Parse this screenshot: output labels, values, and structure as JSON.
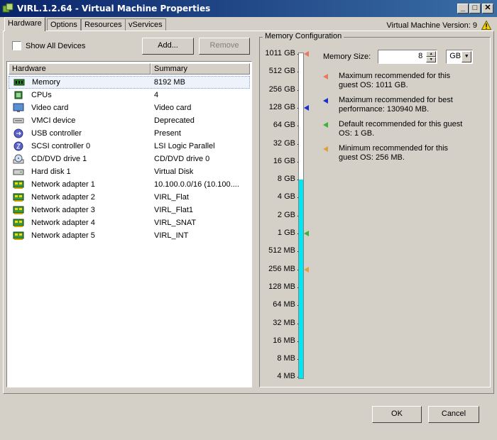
{
  "window": {
    "title": "VIRL.1.2.64 - Virtual Machine Properties"
  },
  "tabs": [
    {
      "label": "Hardware"
    },
    {
      "label": "Options"
    },
    {
      "label": "Resources"
    },
    {
      "label": "vServices"
    }
  ],
  "version_label": "Virtual Machine Version: 9",
  "hardware": {
    "show_all_label": "Show All Devices",
    "add_label": "Add...",
    "remove_label": "Remove",
    "columns": [
      "Hardware",
      "Summary"
    ],
    "rows": [
      {
        "name": "Memory",
        "summary": "8192 MB",
        "icon": "memory-icon",
        "selected": true
      },
      {
        "name": "CPUs",
        "summary": "4",
        "icon": "cpu-icon"
      },
      {
        "name": "Video card",
        "summary": "Video card",
        "icon": "monitor-icon"
      },
      {
        "name": "VMCI device",
        "summary": "Deprecated",
        "icon": "vmci-icon"
      },
      {
        "name": "USB controller",
        "summary": "Present",
        "icon": "usb-icon"
      },
      {
        "name": "SCSI controller 0",
        "summary": "LSI Logic Parallel",
        "icon": "scsi-icon"
      },
      {
        "name": "CD/DVD drive 1",
        "summary": "CD/DVD drive 0",
        "icon": "cd-drive-icon"
      },
      {
        "name": "Hard disk 1",
        "summary": "Virtual Disk",
        "icon": "hard-disk-icon"
      },
      {
        "name": "Network adapter 1",
        "summary": "10.100.0.0/16 (10.100....",
        "icon": "network-adapter-icon"
      },
      {
        "name": "Network adapter 2",
        "summary": "VIRL_Flat",
        "icon": "network-adapter-icon"
      },
      {
        "name": "Network adapter 3",
        "summary": "VIRL_Flat1",
        "icon": "network-adapter-icon"
      },
      {
        "name": "Network adapter 4",
        "summary": "VIRL_SNAT",
        "icon": "network-adapter-icon"
      },
      {
        "name": "Network adapter 5",
        "summary": "VIRL_INT",
        "icon": "network-adapter-icon"
      }
    ]
  },
  "memory": {
    "group_label": "Memory Configuration",
    "size_label": "Memory Size:",
    "size_value": "8",
    "unit": "GB",
    "scale_labels": [
      "1011 GB",
      "512 GB",
      "256 GB",
      "128 GB",
      "64 GB",
      "32 GB",
      "16 GB",
      "8 GB",
      "4 GB",
      "2 GB",
      "1 GB",
      "512 MB",
      "256 MB",
      "128 MB",
      "64 MB",
      "32 MB",
      "16 MB",
      "8 MB",
      "4 MB"
    ],
    "current_index": 7,
    "markers": [
      {
        "index": 0,
        "color": "#e8795c"
      },
      {
        "index": 3,
        "color": "#1a2fd0"
      },
      {
        "index": 10,
        "color": "#3bb33b"
      },
      {
        "index": 12,
        "color": "#e0a040"
      }
    ],
    "legend": [
      {
        "text": "Maximum recommended for this guest OS: 1011 GB.",
        "color": "#e8795c"
      },
      {
        "text": "Maximum recommended for best performance: 130940 MB.",
        "color": "#1a2fd0"
      },
      {
        "text": "Default recommended for this guest OS: 1 GB.",
        "color": "#3bb33b"
      },
      {
        "text": "Minimum recommended for this guest OS: 256 MB.",
        "color": "#e0a040"
      }
    ]
  },
  "footer": {
    "ok_label": "OK",
    "cancel_label": "Cancel"
  }
}
